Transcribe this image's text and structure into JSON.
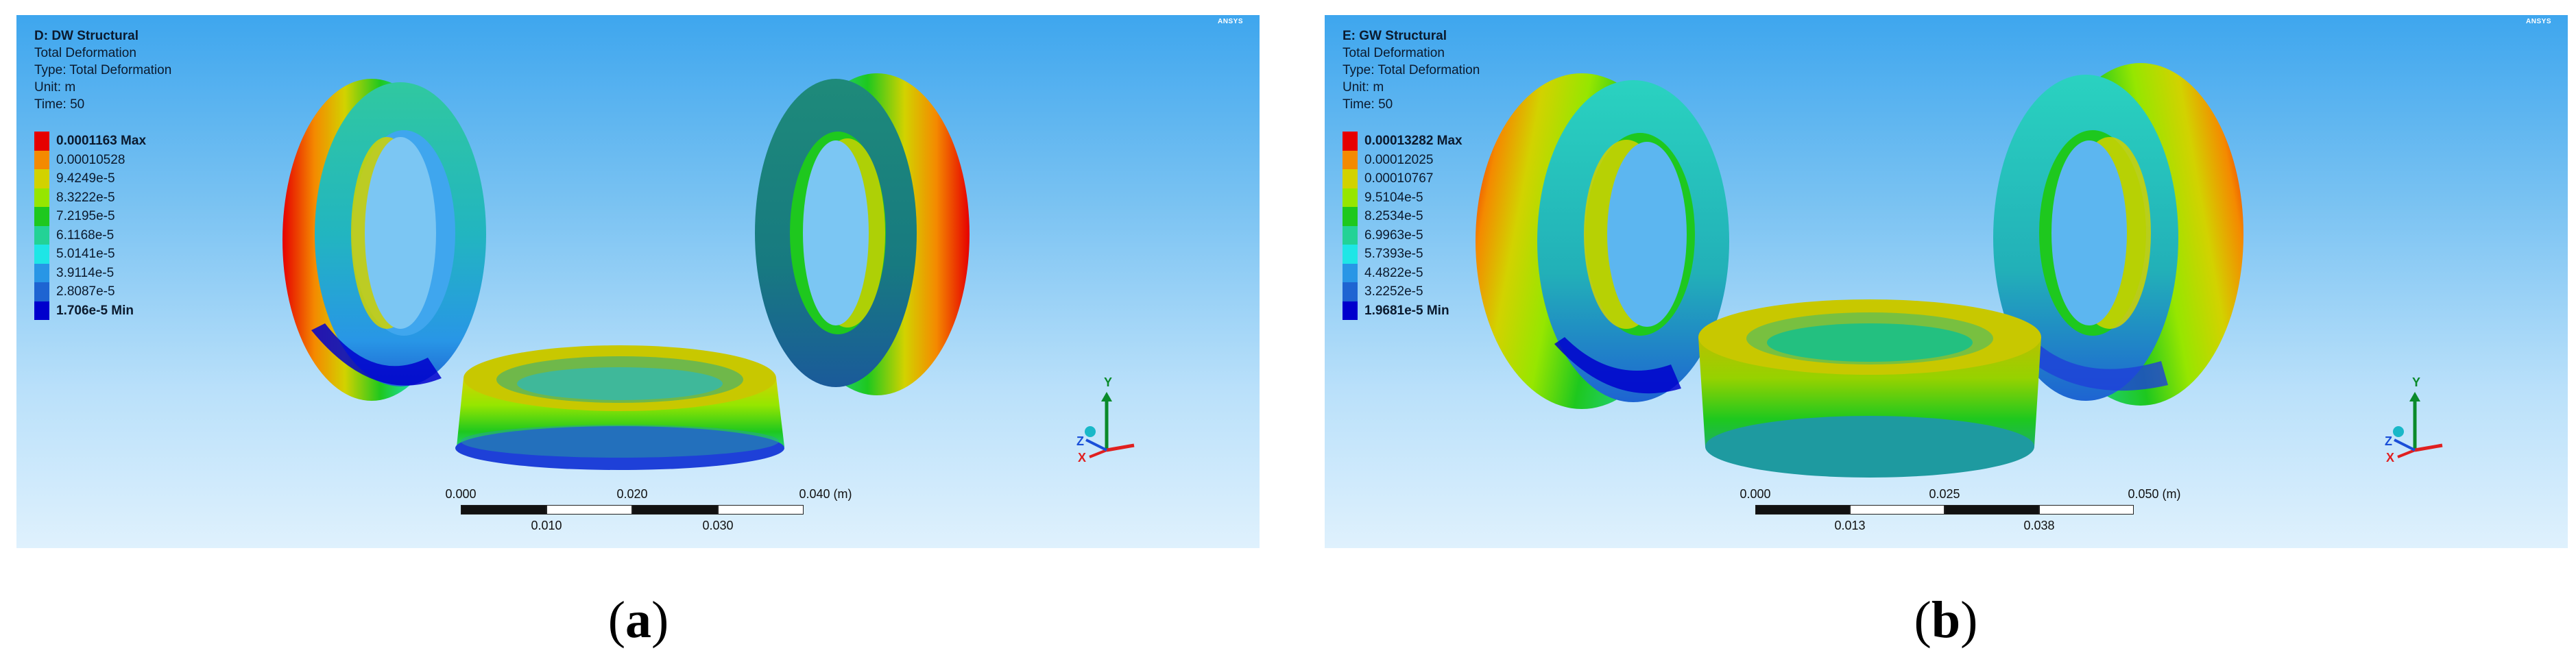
{
  "panels": [
    {
      "header": {
        "title": "D: DW Structural",
        "result": "Total Deformation",
        "type": "Type: Total Deformation",
        "unit": "Unit: m",
        "time": "Time: 50"
      },
      "brand": "ANSYS",
      "legend": [
        "0.0001163 Max",
        "0.00010528",
        "9.4249e-5",
        "8.3222e-5",
        "7.2195e-5",
        "6.1168e-5",
        "5.0141e-5",
        "3.9114e-5",
        "2.8087e-5",
        "1.706e-5 Min"
      ],
      "scale": {
        "top_labels": [
          "0.000",
          "0.020",
          "0.040 (m)"
        ],
        "bottom_labels": [
          "0.010",
          "0.030"
        ]
      },
      "axes": {
        "y": "Y",
        "z": "Z",
        "x": "X"
      },
      "caption": {
        "open": "(",
        "letter": "a",
        "close": ")"
      }
    },
    {
      "header": {
        "title": "E: GW Structural",
        "result": "Total Deformation",
        "type": "Type: Total Deformation",
        "unit": "Unit: m",
        "time": "Time: 50"
      },
      "brand": "ANSYS",
      "legend": [
        "0.00013282 Max",
        "0.00012025",
        "0.00010767",
        "9.5104e-5",
        "8.2534e-5",
        "6.9963e-5",
        "5.7393e-5",
        "4.4822e-5",
        "3.2252e-5",
        "1.9681e-5 Min"
      ],
      "scale": {
        "top_labels": [
          "0.000",
          "0.025",
          "0.050 (m)"
        ],
        "bottom_labels": [
          "0.013",
          "0.038"
        ]
      },
      "axes": {
        "y": "Y",
        "z": "Z",
        "x": "X"
      },
      "caption": {
        "open": "(",
        "letter": "b",
        "close": ")"
      }
    }
  ],
  "colors": {
    "contour": [
      "#e60000",
      "#f48a00",
      "#d2d200",
      "#96e600",
      "#1ec81e",
      "#23d296",
      "#1ee6e6",
      "#2896e6",
      "#1e64d2",
      "#0000cd"
    ],
    "axis_x": "#e02020",
    "axis_y": "#0a8a2a",
    "axis_z": "#1a4fd8"
  }
}
